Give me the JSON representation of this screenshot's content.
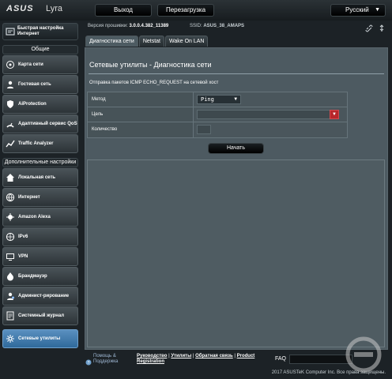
{
  "header": {
    "brand": "ASUS",
    "model": "Lyra",
    "logout": "Выход",
    "reboot": "Перезагрузка",
    "language": "Русский"
  },
  "info": {
    "fw_label": "Версия прошивки:",
    "fw_value": "3.0.0.4.382_11389",
    "ssid_label": "SSID:",
    "ssid_value": "ASUS_38_AMAPS"
  },
  "sidebar": {
    "quick": "Быстрая настройка Интернет",
    "general_head": "Общие",
    "general": [
      {
        "label": "Карта сети",
        "icon": "network-map-icon"
      },
      {
        "label": "Гостевая сеть",
        "icon": "guest-network-icon"
      },
      {
        "label": "AiProtection",
        "icon": "shield-icon"
      },
      {
        "label": "Адаптивный сервис QoS",
        "icon": "qos-icon"
      },
      {
        "label": "Traffic Analyzer",
        "icon": "chart-icon"
      }
    ],
    "advanced_head": "Дополнительные настройки",
    "advanced": [
      {
        "label": "Локальная сеть",
        "icon": "home-icon"
      },
      {
        "label": "Интернет",
        "icon": "globe-icon"
      },
      {
        "label": "Amazon Alexa",
        "icon": "alexa-icon"
      },
      {
        "label": "IPv6",
        "icon": "ipv6-icon"
      },
      {
        "label": "VPN",
        "icon": "vpn-icon"
      },
      {
        "label": "Брандмауэр",
        "icon": "firewall-icon"
      },
      {
        "label": "Админист-рирование",
        "icon": "admin-icon"
      },
      {
        "label": "Системный журнал",
        "icon": "log-icon"
      },
      {
        "label": "Сетевые утилиты",
        "icon": "tools-icon"
      }
    ]
  },
  "tabs": [
    "Диагностика сети",
    "Netstat",
    "Wake On LAN"
  ],
  "main": {
    "title": "Сетевые утилиты - Диагностика сети",
    "description": "Отправка пакетов ICMP ECHO_REQUEST на сетевой хост",
    "method_label": "Метод",
    "method_value": "Ping",
    "target_label": "Цель",
    "count_label": "Количество",
    "start": "Начать"
  },
  "footer": {
    "help": "Помощь & Поддержка",
    "links": [
      "Руководство",
      "Утилиты",
      "Обратная связь",
      "Product Registration"
    ],
    "faq": "FAQ",
    "copyright": "2017 ASUSTeK Computer Inc. Все права защищены."
  },
  "colors": {
    "active": "#3a7ab0",
    "accent_red": "#b8272b"
  }
}
